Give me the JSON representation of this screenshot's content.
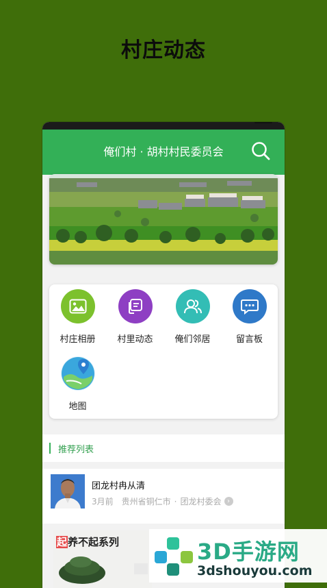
{
  "promo": {
    "title": "村庄动态"
  },
  "app": {
    "header_title": "俺们村 · 胡村村民委员会",
    "search_icon": "search-icon",
    "accent": "#33b057"
  },
  "features": [
    {
      "label": "村庄相册",
      "icon": "photo-icon",
      "color": "#7cc12d"
    },
    {
      "label": "村里动态",
      "icon": "message-card-icon",
      "color": "#8e3fc3"
    },
    {
      "label": "俺们邻居",
      "icon": "people-icon",
      "color": "#33bdb5"
    },
    {
      "label": "留言板",
      "icon": "chat-bubble-icon",
      "color": "#2f79c8"
    },
    {
      "label": "地图",
      "icon": "map-pin-icon",
      "color": "#3aa7dd"
    }
  ],
  "recommend": {
    "section_title": "推荐列表"
  },
  "post": {
    "name": "团龙村冉从清",
    "time": "3月前",
    "location": "贵州省铜仁市",
    "org": "团龙村委会"
  },
  "video": {
    "caption_highlight": "起",
    "caption": "养不起系列"
  },
  "watermark": {
    "main": "3D手游网",
    "sub": "3dshouyou.com"
  }
}
